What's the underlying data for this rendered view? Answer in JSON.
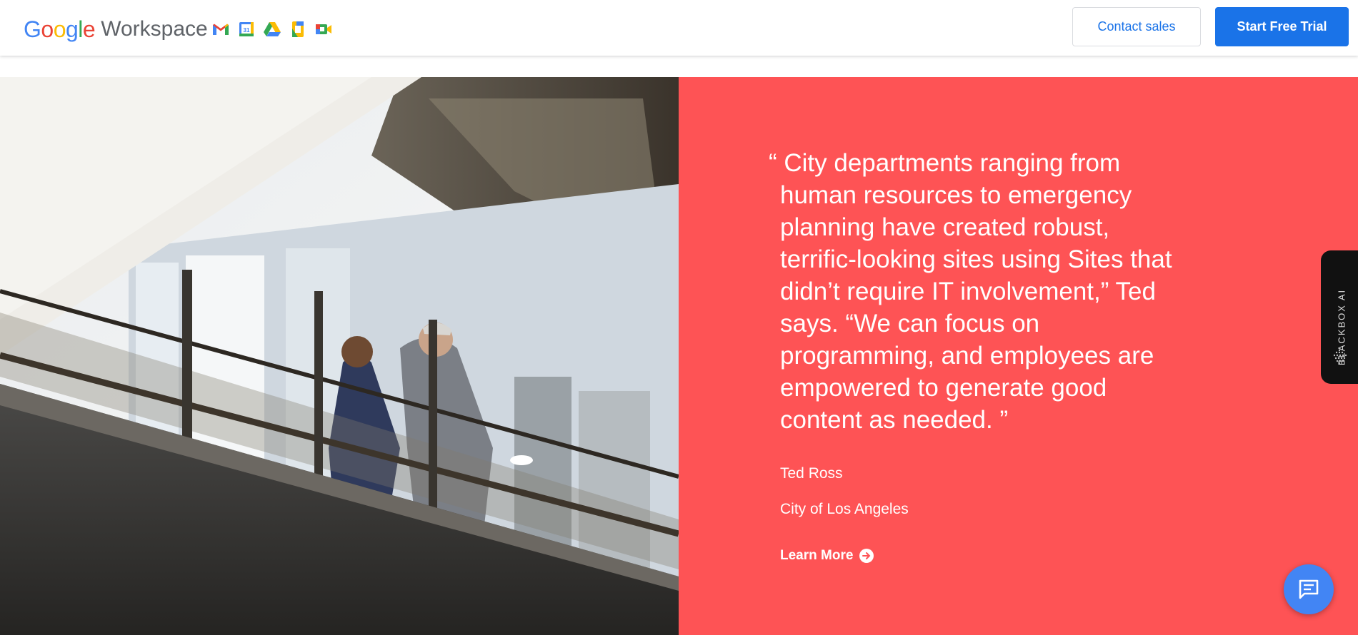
{
  "header": {
    "brand_google": "Google",
    "brand_product": "Workspace",
    "apps": [
      "gmail-icon",
      "calendar-icon",
      "drive-icon",
      "docs-icon",
      "meet-icon"
    ],
    "calendar_day": "31",
    "contact_label": "Contact sales",
    "trial_label": "Start Free Trial"
  },
  "colors": {
    "quote_panel": "#fe5355",
    "primary_blue": "#1a73e8",
    "chat_fab": "#4285f4"
  },
  "testimonial": {
    "quote_lines": [
      "“ City departments ranging from",
      "human resources to emergency",
      "planning have created robust,",
      "terrific-looking sites using Sites that",
      "didn’t require IT involvement,” Ted",
      "says. “We can focus on",
      "programming, and employees are",
      "empowered to generate good",
      "content as needed. ”"
    ],
    "author": "Ted Ross",
    "organization": "City of Los Angeles",
    "learn_more": "Learn More"
  },
  "extension_tab": {
    "label": "BLACKBOX AI"
  }
}
